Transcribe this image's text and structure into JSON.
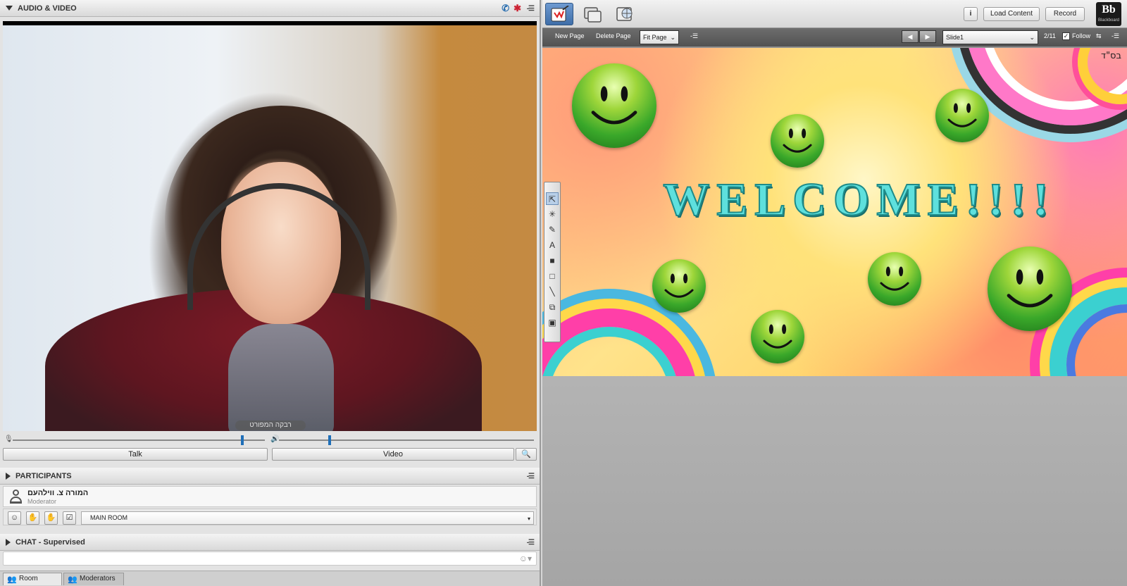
{
  "audio_video": {
    "title": "AUDIO & VIDEO",
    "camera_label": "רבקה המפורט",
    "talk_label": "Talk",
    "video_label": "Video"
  },
  "participants": {
    "title": "PARTICIPANTS",
    "name": "המורה צ. ווילהעם",
    "role": "Moderator",
    "room": "MAIN ROOM"
  },
  "chat": {
    "title": "CHAT - Supervised",
    "input_value": ""
  },
  "bottom_tabs": [
    "Room",
    "Moderators"
  ],
  "topbar": {
    "info_label": "i",
    "load_content_label": "Load Content",
    "record_label": "Record",
    "logo_text": "Bb",
    "logo_sub": "Blackboard"
  },
  "subbar": {
    "new_page": "New Page",
    "delete_page": "Delete Page",
    "zoom": "Fit Page",
    "slide_name": "Slide1",
    "page_count": "2/11",
    "follow_label": "Follow",
    "follow_checked": true
  },
  "slide": {
    "welcome_text": "WELCOME!!!!",
    "corner_text": "בס\"ד"
  },
  "colors": {
    "accent": "#1f6fb8",
    "welcome": "#5ee0dd",
    "subbar": "#5f5f5f"
  }
}
